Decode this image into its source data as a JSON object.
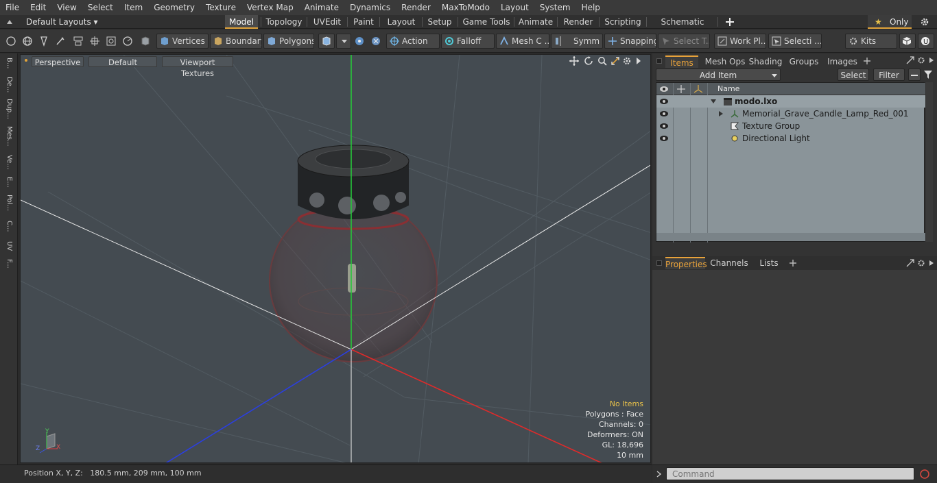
{
  "menu": [
    "File",
    "Edit",
    "View",
    "Select",
    "Item",
    "Geometry",
    "Texture",
    "Vertex Map",
    "Animate",
    "Dynamics",
    "Render",
    "MaxToModo",
    "Layout",
    "System",
    "Help"
  ],
  "layouts": {
    "dropdown_label": "Default Layouts ▾",
    "only_label": "Only"
  },
  "layout_tabs": [
    "Model",
    "Topology",
    "UVEdit",
    "Paint",
    "Layout",
    "Setup",
    "Game Tools",
    "Animate",
    "Render",
    "Scripting",
    "Schematic Fusion"
  ],
  "toolbar": {
    "vertices": "Vertices",
    "boundary": "Boundary",
    "polygons": "Polygons",
    "action": "Action",
    "falloff": "Falloff",
    "meshc": "Mesh C ...",
    "symm": "Symm ...",
    "snapping": "Snapping",
    "selectt": "Select T...",
    "workpl": "Work Pl...",
    "selecti": "Selecti ...",
    "kits": "Kits"
  },
  "left_tabs": [
    "B...",
    "De...",
    "Dup...",
    "Mes...",
    "Ve...",
    "E...",
    "Pol...",
    "C...",
    "UV",
    "F..."
  ],
  "viewport": {
    "view_mode": "Perspective",
    "shading": "Default",
    "textures": "Viewport Textures",
    "info": {
      "items": "No Items",
      "polygons": "Polygons : Face",
      "channels": "Channels: 0",
      "deformers": "Deformers: ON",
      "gl": "GL: 18,696",
      "scale": "10 mm"
    },
    "axis": {
      "x": "X",
      "y": "Y",
      "z": "Z"
    }
  },
  "status": {
    "position": "Position X, Y, Z:   180.5 mm, 209 mm, 100 mm"
  },
  "right_panel": {
    "tabs": [
      "Items",
      "Mesh Ops",
      "Shading",
      "Groups",
      "Images"
    ],
    "add_item": "Add Item",
    "select": "Select",
    "filter": "Filter",
    "name_header": "Name",
    "tree": [
      "modo.lxo",
      "Memorial_Grave_Candle_Lamp_Red_001",
      "Texture Group",
      "Directional Light"
    ],
    "prop_tabs": [
      "Properties",
      "Channels",
      "Lists"
    ],
    "command_placeholder": "Command"
  },
  "colors": {
    "accent": "#e8a23a",
    "viewport_bg": "#444b51",
    "list_bg": "#8a9499"
  }
}
